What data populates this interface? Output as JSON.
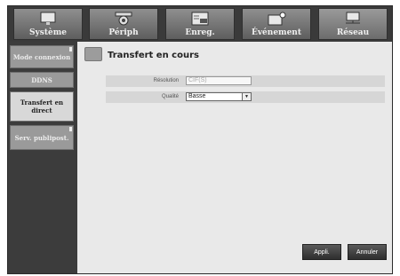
{
  "tabs": [
    {
      "label": "Système",
      "icon": "system-monitor-icon"
    },
    {
      "label": "Périph",
      "icon": "camera-device-icon"
    },
    {
      "label": "Enreg.",
      "icon": "rec-record-icon"
    },
    {
      "label": "Événement",
      "icon": "event-alarm-icon"
    },
    {
      "label": "Réseau",
      "icon": "network-computer-icon"
    }
  ],
  "active_tab": "Réseau",
  "sidebar": {
    "items": [
      {
        "label": "Mode connexion"
      },
      {
        "label": "DDNS"
      },
      {
        "label": "Transfert en direct"
      },
      {
        "label": "Serv. publipost."
      }
    ],
    "active_item": "Transfert en direct"
  },
  "main": {
    "title": "Transfert en cours",
    "resolution_label": "Résolution",
    "resolution_value": "CIF(S)",
    "quality_label": "Qualité",
    "quality_value": "Basse"
  },
  "buttons": {
    "apply": "Appli.",
    "cancel": "Annuler"
  }
}
